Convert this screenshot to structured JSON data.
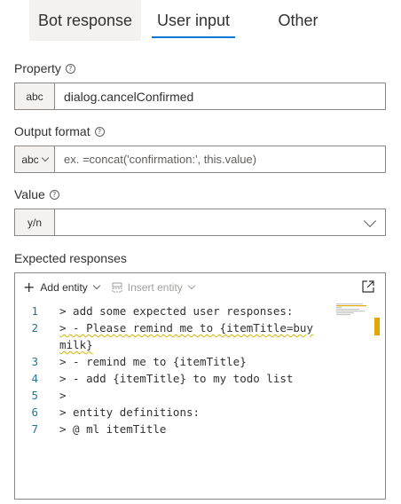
{
  "tabs": [
    {
      "label": "Bot response"
    },
    {
      "label": "User input"
    },
    {
      "label": "Other"
    }
  ],
  "property": {
    "label": "Property",
    "type_prefix": "abc",
    "value": "dialog.cancelConfirmed"
  },
  "output_format": {
    "label": "Output format",
    "type_prefix": "abc",
    "placeholder": "ex. =concat('confirmation:', this.value)"
  },
  "value_field": {
    "label": "Value",
    "type_prefix": "y/n",
    "value": ""
  },
  "expected_responses": {
    "label": "Expected responses",
    "toolbar": {
      "add_entity": "Add entity",
      "insert_entity": "Insert entity"
    },
    "lines": [
      {
        "num": "1",
        "text": "> add some expected user responses:"
      },
      {
        "num": "2",
        "text": "> - Please remind me to {itemTitle=buy"
      },
      {
        "num": "",
        "text": "milk}"
      },
      {
        "num": "3",
        "text": "> - remind me to {itemTitle}"
      },
      {
        "num": "4",
        "text": "> - add {itemTitle} to my todo list"
      },
      {
        "num": "5",
        "text": ">"
      },
      {
        "num": "6",
        "text": "> entity definitions:"
      },
      {
        "num": "7",
        "text": "> @ ml itemTitle"
      }
    ]
  },
  "colors": {
    "accent": "#0078d4",
    "line_number": "#237893",
    "warning": "#e0a800"
  }
}
